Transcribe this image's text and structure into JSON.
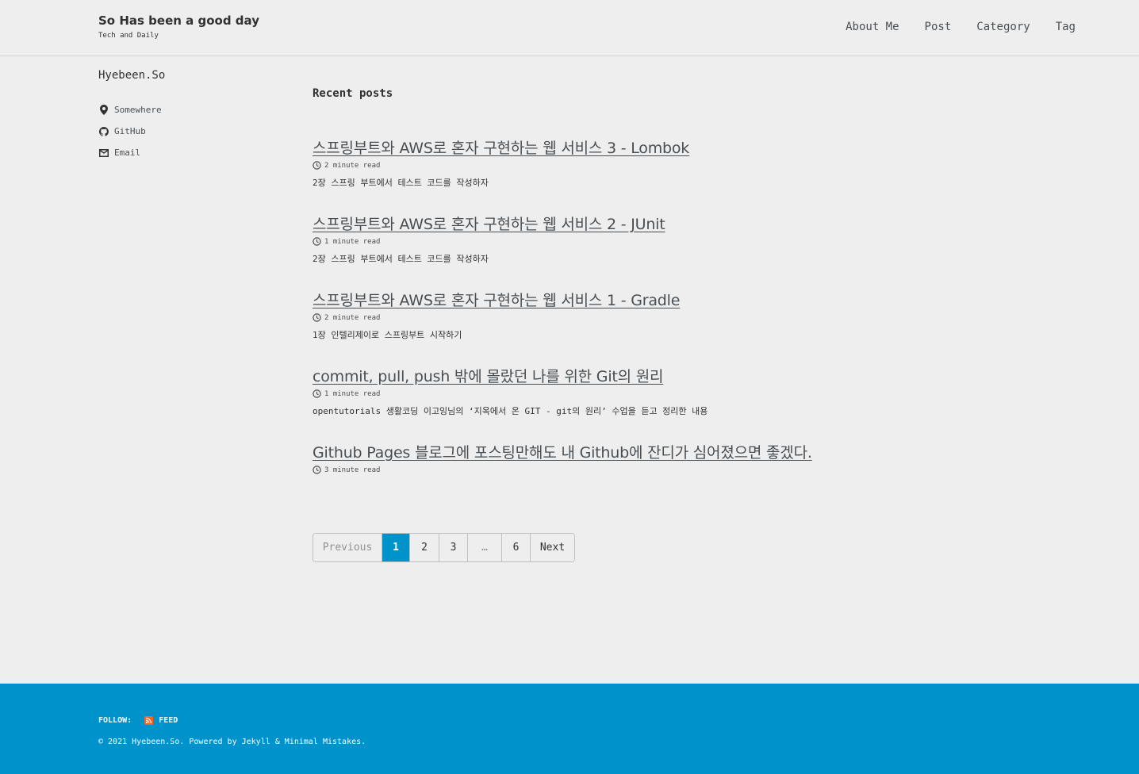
{
  "header": {
    "site_title": "So Has been a good day",
    "site_subtitle": "Tech and Daily",
    "nav": [
      "About Me",
      "Post",
      "Category",
      "Tag"
    ]
  },
  "sidebar": {
    "author_name": "Hyebeen.So",
    "links": [
      {
        "icon": "map-marker-icon",
        "label": "Somewhere"
      },
      {
        "icon": "github-icon",
        "label": "GitHub"
      },
      {
        "icon": "email-icon",
        "label": "Email"
      }
    ]
  },
  "main": {
    "heading": "Recent posts",
    "posts": [
      {
        "title": "스프링부트와 AWS로 혼자 구현하는 웹 서비스 3 - Lombok",
        "read_time": "2 minute read",
        "excerpt": "2장 스프링 부트에서 테스트 코드를 작성하자"
      },
      {
        "title": "스프링부트와 AWS로 혼자 구현하는 웹 서비스 2 - JUnit",
        "read_time": "1 minute read",
        "excerpt": "2장 스프링 부트에서 테스트 코드를 작성하자"
      },
      {
        "title": "스프링부트와 AWS로 혼자 구현하는 웹 서비스 1 - Gradle",
        "read_time": "2 minute read",
        "excerpt": "1장 인텔리제이로 스프링부트 시작하기"
      },
      {
        "title": "commit, pull, push 밖에 몰랐던 나를 위한 Git의 원리",
        "read_time": "1 minute read",
        "excerpt": "opentutorials 생활코딩 이고잉님의 ‘지옥에서 온 GIT - git의 원리’ 수업을 듣고 정리한 내용"
      },
      {
        "title": "Github Pages 블로그에 포스팅만해도 내 Github에 잔디가 심어졌으면 좋겠다.",
        "read_time": "3 minute read",
        "excerpt": ""
      }
    ]
  },
  "pagination": {
    "items": [
      {
        "label": "Previous",
        "state": "disabled"
      },
      {
        "label": "1",
        "state": "current"
      },
      {
        "label": "2",
        "state": "normal"
      },
      {
        "label": "3",
        "state": "normal"
      },
      {
        "label": "…",
        "state": "disabled"
      },
      {
        "label": "6",
        "state": "normal"
      },
      {
        "label": "Next",
        "state": "normal"
      }
    ]
  },
  "footer": {
    "follow_label": "FOLLOW:",
    "feed_label": "FEED",
    "copyright": "© 2021 Hyebeen.So. Powered by Jekyll & Minimal Mistakes."
  },
  "colors": {
    "background": "#eeeeee",
    "footer": "#0092ca",
    "current_page": "#0092ca",
    "feed_icon": "#f26522"
  }
}
